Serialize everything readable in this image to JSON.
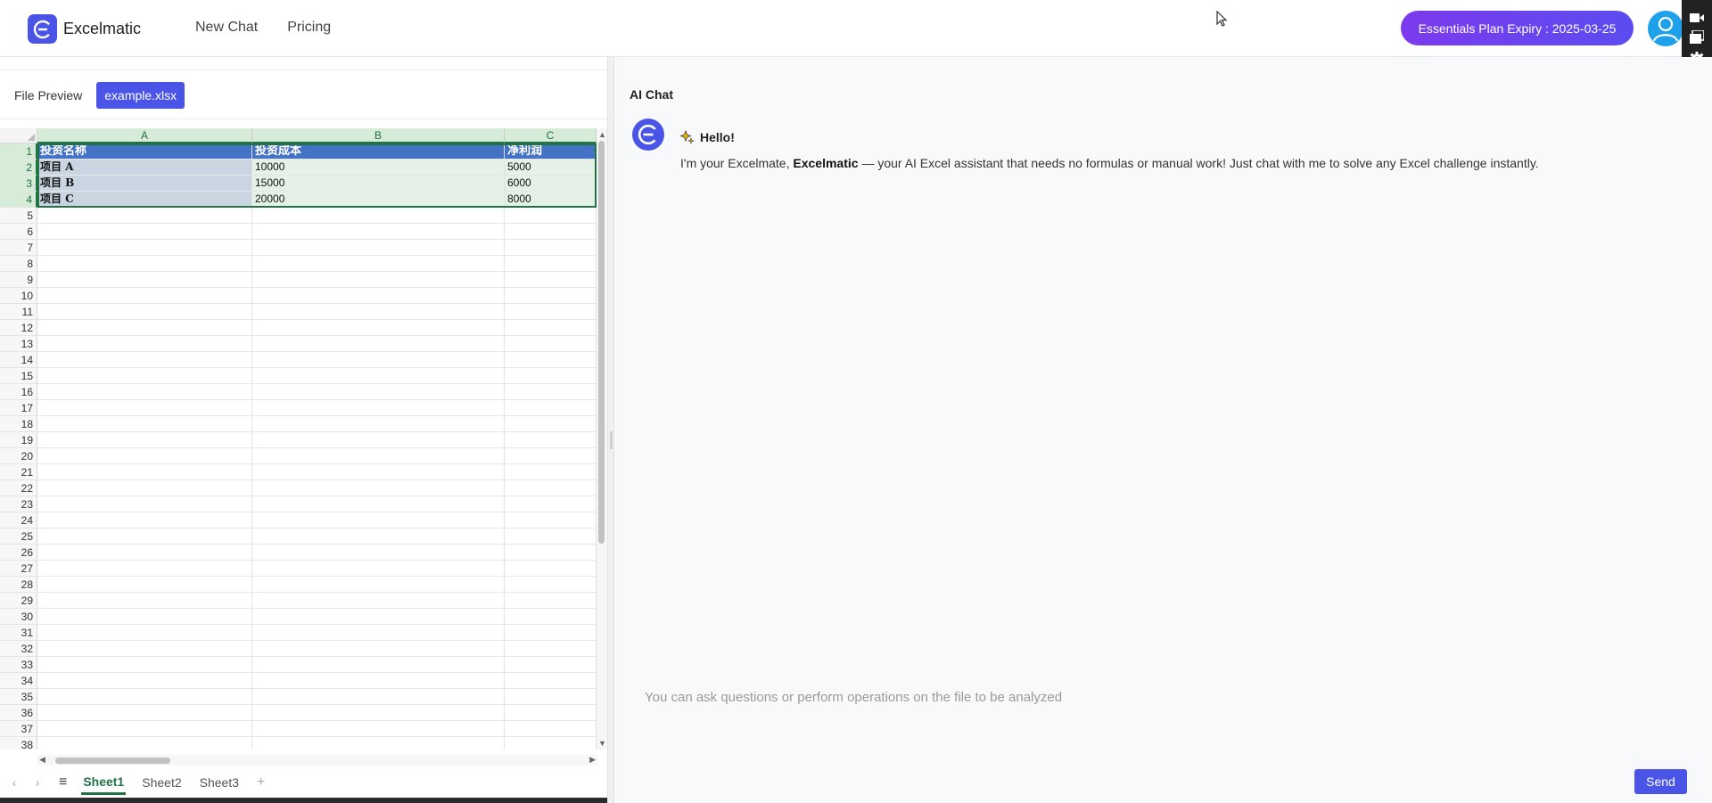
{
  "app": {
    "name": "Excelmatic"
  },
  "nav": {
    "new_chat": "New Chat",
    "pricing": "Pricing"
  },
  "plan_button": "Essentials Plan Expiry : 2025-03-25",
  "file_preview": {
    "label": "File Preview",
    "file_name": "example.xlsx"
  },
  "spreadsheet": {
    "columns": [
      "A",
      "B",
      "C"
    ],
    "rows": [
      [
        "投资名称",
        "投资成本",
        "净利润"
      ],
      [
        "项目 A",
        "10000",
        "5000"
      ],
      [
        "项目 B",
        "15000",
        "6000"
      ],
      [
        "项目 C",
        "20000",
        "8000"
      ]
    ],
    "row_numbers": [
      "1",
      "2",
      "3",
      "4",
      "5",
      "6",
      "7",
      "8",
      "9",
      "10",
      "11",
      "12",
      "13",
      "14",
      "15",
      "16",
      "17",
      "18",
      "19",
      "20",
      "21",
      "22",
      "23",
      "24",
      "25",
      "26",
      "27",
      "28",
      "29",
      "30",
      "31",
      "32",
      "33",
      "34",
      "35",
      "36",
      "37",
      "38"
    ],
    "sheets": [
      "Sheet1",
      "Sheet2",
      "Sheet3"
    ],
    "active_sheet": "Sheet1",
    "add_sheet": "+",
    "menu_icon": "≡"
  },
  "chat": {
    "title": "AI Chat",
    "greeting": "Hello!",
    "intro_prefix": "I'm your Excelmate, ",
    "intro_brand": "Excelmatic",
    "intro_suffix": " — your AI Excel assistant that needs no formulas or manual work! Just chat with me to solve any Excel challenge instantly.",
    "input_placeholder": "You can ask questions or perform operations on the file to be analyzed",
    "send_label": "Send"
  },
  "colors": {
    "accent": "#4a55e8",
    "plan_gradient_start": "#7c3aed",
    "header_fill": "#4472c4",
    "excel_green": "#217346"
  }
}
